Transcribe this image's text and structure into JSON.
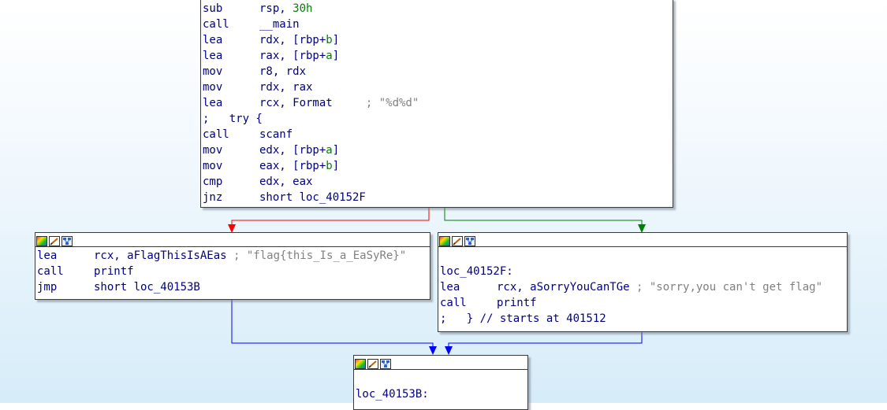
{
  "colors": {
    "edge_false": "#ff0000",
    "edge_true": "#008000",
    "edge_uncond": "#0000ff",
    "text": "#000080",
    "number": "#008000",
    "comment": "#808080"
  },
  "header_icons": [
    "color-palette-icon",
    "rename-pencil-icon",
    "graph-overview-icon"
  ],
  "main_block": {
    "lines": [
      {
        "mnemonic": "sub",
        "parts": [
          {
            "t": "rsp, ",
            "c": "op"
          },
          {
            "t": "30h",
            "c": "num"
          }
        ]
      },
      {
        "mnemonic": "call",
        "parts": [
          {
            "t": "__main",
            "c": "op"
          }
        ]
      },
      {
        "mnemonic": "lea",
        "parts": [
          {
            "t": "rdx, [rbp+",
            "c": "op"
          },
          {
            "t": "b",
            "c": "var"
          },
          {
            "t": "]",
            "c": "op"
          }
        ]
      },
      {
        "mnemonic": "lea",
        "parts": [
          {
            "t": "rax, [rbp+",
            "c": "op"
          },
          {
            "t": "a",
            "c": "var"
          },
          {
            "t": "]",
            "c": "op"
          }
        ]
      },
      {
        "mnemonic": "mov",
        "parts": [
          {
            "t": "r8, rdx",
            "c": "op"
          }
        ]
      },
      {
        "mnemonic": "mov",
        "parts": [
          {
            "t": "rdx, rax",
            "c": "op"
          }
        ]
      },
      {
        "mnemonic": "lea",
        "parts": [
          {
            "t": "rcx, Format     ",
            "c": "op"
          },
          {
            "t": "; \"%d%d\"",
            "c": "cmt"
          }
        ]
      },
      {
        "mnemonic": ";   try {",
        "parts": []
      },
      {
        "mnemonic": "call",
        "parts": [
          {
            "t": "scanf",
            "c": "op"
          }
        ]
      },
      {
        "mnemonic": "mov",
        "parts": [
          {
            "t": "edx, [rbp+",
            "c": "op"
          },
          {
            "t": "a",
            "c": "var"
          },
          {
            "t": "]",
            "c": "op"
          }
        ]
      },
      {
        "mnemonic": "mov",
        "parts": [
          {
            "t": "eax, [rbp+",
            "c": "op"
          },
          {
            "t": "b",
            "c": "var"
          },
          {
            "t": "]",
            "c": "op"
          }
        ]
      },
      {
        "mnemonic": "cmp",
        "parts": [
          {
            "t": "edx, eax",
            "c": "op"
          }
        ]
      },
      {
        "mnemonic": "jnz",
        "parts": [
          {
            "t": "short loc_40152F",
            "c": "op"
          }
        ]
      }
    ]
  },
  "left_block": {
    "lines": [
      {
        "mnemonic": "lea",
        "parts": [
          {
            "t": "rcx, aFlagThisIsAEas ",
            "c": "op"
          },
          {
            "t": "; \"flag{this_Is_a_EaSyRe}\"",
            "c": "cmt"
          }
        ]
      },
      {
        "mnemonic": "call",
        "parts": [
          {
            "t": "printf",
            "c": "op"
          }
        ]
      },
      {
        "mnemonic": "jmp",
        "parts": [
          {
            "t": "short loc_40153B",
            "c": "op"
          }
        ]
      }
    ]
  },
  "right_block": {
    "lines": [
      {
        "mnemonic": "",
        "parts": []
      },
      {
        "mnemonic": "loc_40152F:",
        "parts": []
      },
      {
        "mnemonic": "lea",
        "parts": [
          {
            "t": "rcx, aSorryYouCanTGe ",
            "c": "op"
          },
          {
            "t": "; \"sorry,you can't get flag\"",
            "c": "cmt"
          }
        ]
      },
      {
        "mnemonic": "call",
        "parts": [
          {
            "t": "printf",
            "c": "op"
          }
        ]
      },
      {
        "mnemonic": ";   } // starts at 401512",
        "parts": []
      }
    ]
  },
  "bottom_block": {
    "lines": [
      {
        "mnemonic": "",
        "parts": []
      },
      {
        "mnemonic": "loc_40153B:",
        "parts": []
      }
    ]
  }
}
